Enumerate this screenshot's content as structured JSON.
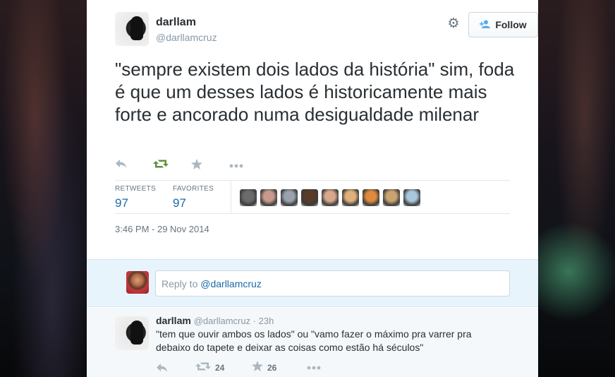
{
  "background": {
    "card_color": "#ffffff",
    "reply_bg": "#e8f4fb",
    "accent": "#55acee",
    "link_color": "#1b6aa5"
  },
  "tweet": {
    "author_name": "darllam",
    "author_handle": "@darllamcruz",
    "follow_label": "Follow",
    "text": "\"sempre existem dois lados da história\" sim, foda é que um desses lados é historicamente mais forte e ancorado numa desigualdade milenar",
    "actions": {
      "reply_icon": "reply-icon",
      "retweet_icon": "retweet-icon",
      "favorite_icon": "star-icon",
      "more_icon": "more-icon"
    },
    "stats": {
      "retweets_label": "RETWEETS",
      "retweets_value": "97",
      "favorites_label": "FAVORITES",
      "favorites_value": "97"
    },
    "faces": [
      "#6b6b6b",
      "#c79a8c",
      "#9aa3ad",
      "#5a3b2a",
      "#d9a78c",
      "#e0b07a",
      "#e08a3c",
      "#c9a46e",
      "#a8c6dd"
    ],
    "timestamp": "3:46 PM - 29 Nov 2014"
  },
  "reply_box": {
    "prefix": "Reply to ",
    "mention": "@darllamcruz"
  },
  "reply_tweet": {
    "author_name": "darllam",
    "author_handle": "@darllamcruz",
    "separator": " · ",
    "time": "23h",
    "text": "\"tem que ouvir ambos os lados\" ou \"vamo fazer o máximo pra varrer pra debaixo do tapete e deixar as coisas como estão há séculos\"",
    "retweet_count": "24",
    "favorite_count": "26"
  }
}
